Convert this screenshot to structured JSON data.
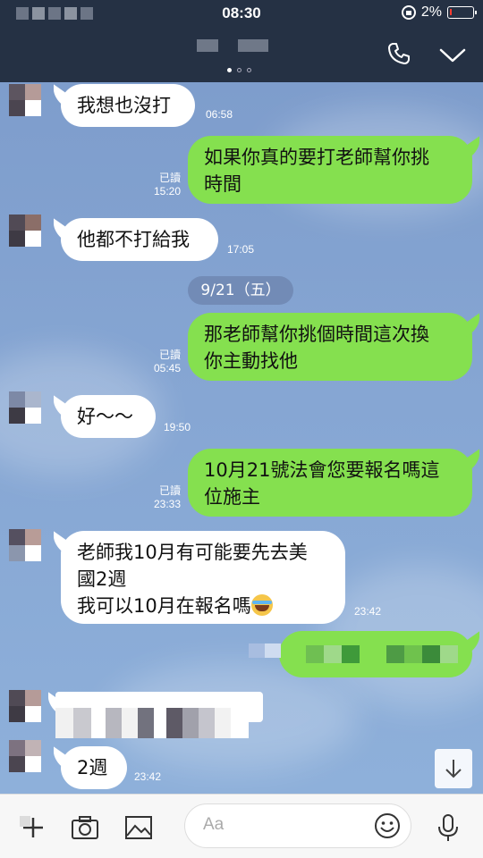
{
  "status_bar": {
    "time": "08:30",
    "battery": "2%"
  },
  "date_divider": "9/21（五）",
  "messages": [
    {
      "dir": "in",
      "text": "我想也沒打",
      "time": "06:58"
    },
    {
      "dir": "out",
      "line1": "如果你真的要打老師幫你挑",
      "line2": "時間",
      "read": "已讀",
      "time": "15:20"
    },
    {
      "dir": "in",
      "text": "他都不打給我",
      "time": "17:05"
    },
    {
      "dir": "out",
      "line1": "那老師幫你挑個時間這次換",
      "line2": "你主動找他",
      "read": "已讀",
      "time": "05:45"
    },
    {
      "dir": "in",
      "text": "好～～",
      "time": "19:50"
    },
    {
      "dir": "out",
      "line1": "10月21號法會您要報名嗎這",
      "line2": "位施主",
      "read": "已讀",
      "time": "23:33"
    },
    {
      "dir": "in",
      "line1": "老師我10月有可能要先去美",
      "line2": "國2週",
      "line3": "我可以10月在報名嗎",
      "emoji": "face-with-tears-of-joy",
      "time": "23:42"
    },
    {
      "dir": "in",
      "text": "2週",
      "time": "23:42"
    }
  ],
  "input": {
    "placeholder": "Aa"
  },
  "icons": {
    "call": "phone-icon",
    "collapse": "chevron-down-icon",
    "scroll": "arrow-down-icon",
    "more": "plus-icon",
    "camera": "camera-icon",
    "photo": "image-icon",
    "emoji": "smiley-icon",
    "mic": "microphone-icon"
  },
  "colors": {
    "header": "#253144",
    "out_bubble": "#85e04f",
    "in_bubble": "#ffffff",
    "chat_bg": "#7d9fd0"
  }
}
